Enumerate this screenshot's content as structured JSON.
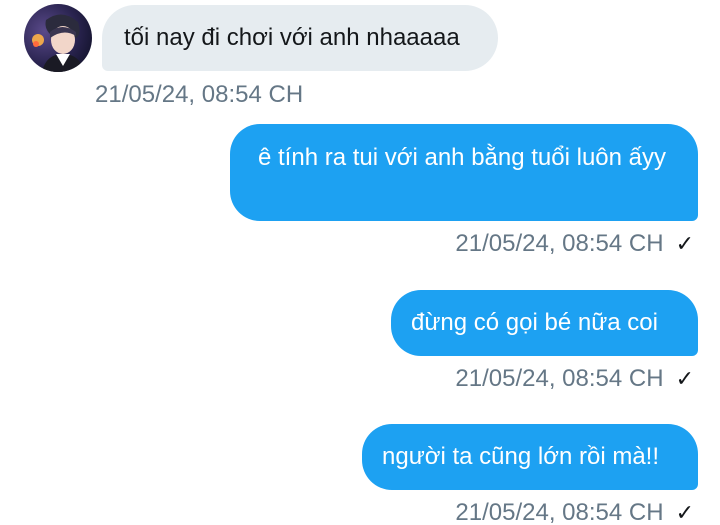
{
  "conversation": {
    "messages": [
      {
        "direction": "incoming",
        "text": "tối nay đi chơi với anh nhaaaaa",
        "timestamp": "21/05/24, 08:54 CH"
      },
      {
        "direction": "outgoing",
        "text": "ê tính ra tui với anh bằng tuổi luôn ấyy",
        "timestamp": "21/05/24, 08:54 CH",
        "status_icon": "check-icon",
        "status_glyph": "✓"
      },
      {
        "direction": "outgoing",
        "text": "đừng có gọi bé nữa coi",
        "timestamp": "21/05/24, 08:54 CH",
        "status_icon": "check-icon",
        "status_glyph": "✓"
      },
      {
        "direction": "outgoing",
        "text": "người ta cũng lớn rồi mà!!",
        "timestamp": "21/05/24, 08:54 CH",
        "status_icon": "check-icon",
        "status_glyph": "✓"
      }
    ]
  },
  "colors": {
    "incoming_bubble": "#e6ecf0",
    "outgoing_bubble": "#1da1f2",
    "timestamp_text": "#657786"
  }
}
